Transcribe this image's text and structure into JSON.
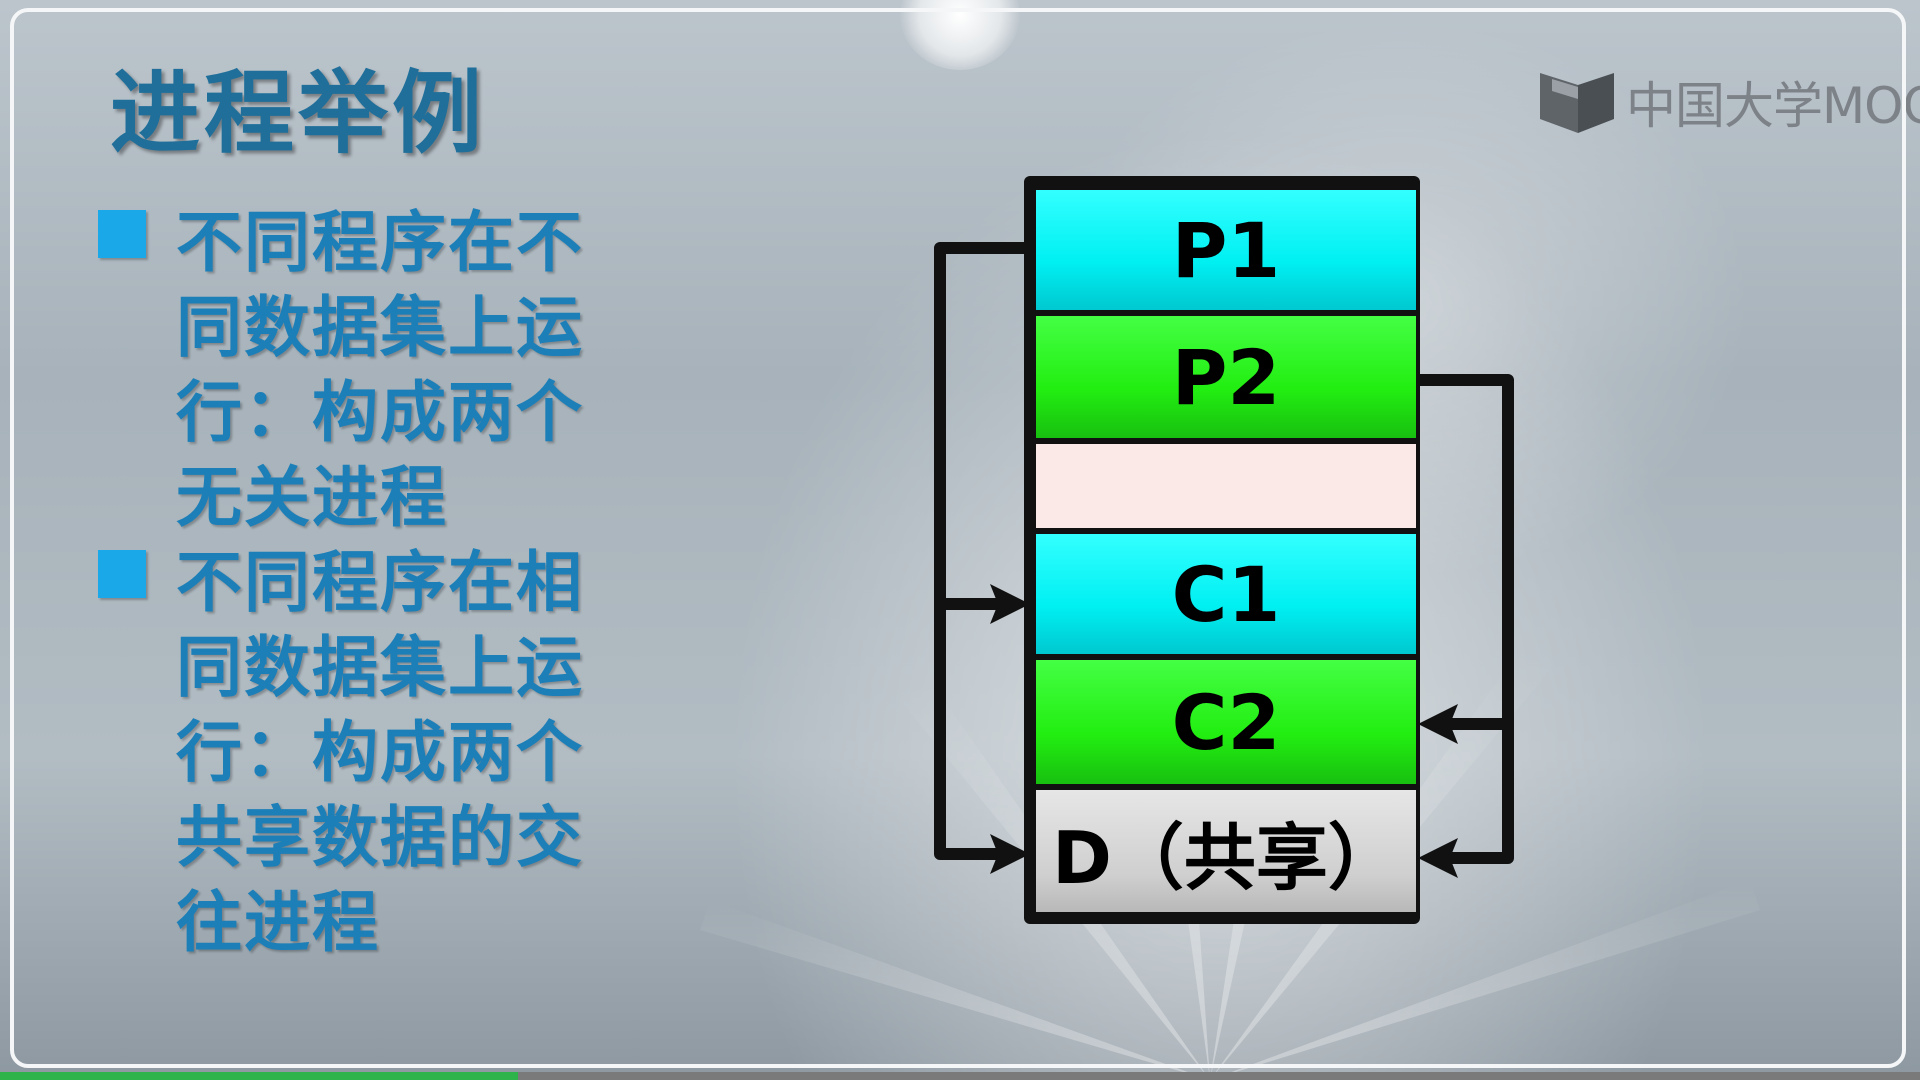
{
  "slide": {
    "title": "进程举例",
    "logo_text": "中国大学MOOC",
    "bullets": [
      {
        "text": "不同程序在不同数据集上运行：构成两个无关进程"
      },
      {
        "text": "不同程序在相同数据集上运行：构成两个共享数据的交往进程"
      }
    ]
  },
  "diagram": {
    "segments": [
      {
        "label": "P1",
        "color": "#00f0f2"
      },
      {
        "label": "P2",
        "color": "#22ee11"
      },
      {
        "label": "",
        "color": "#fbe9e7"
      },
      {
        "label": "C1",
        "color": "#00f0f2"
      },
      {
        "label": "C2",
        "color": "#22ee11"
      },
      {
        "label": "D（共享）",
        "color": "#cfcfcf"
      }
    ],
    "links": [
      {
        "from": "P1",
        "to": "C1"
      },
      {
        "from": "P1",
        "to": "D（共享）"
      },
      {
        "from": "P2",
        "to": "C2"
      },
      {
        "from": "P2",
        "to": "D（共享）"
      }
    ]
  },
  "playback": {
    "progress_fraction": 0.27
  },
  "colors": {
    "title": "#1f6f9a",
    "bullet_text": "#1d7fb8",
    "bullet_square": "#1aa8e8",
    "progress": "#2db34a"
  }
}
